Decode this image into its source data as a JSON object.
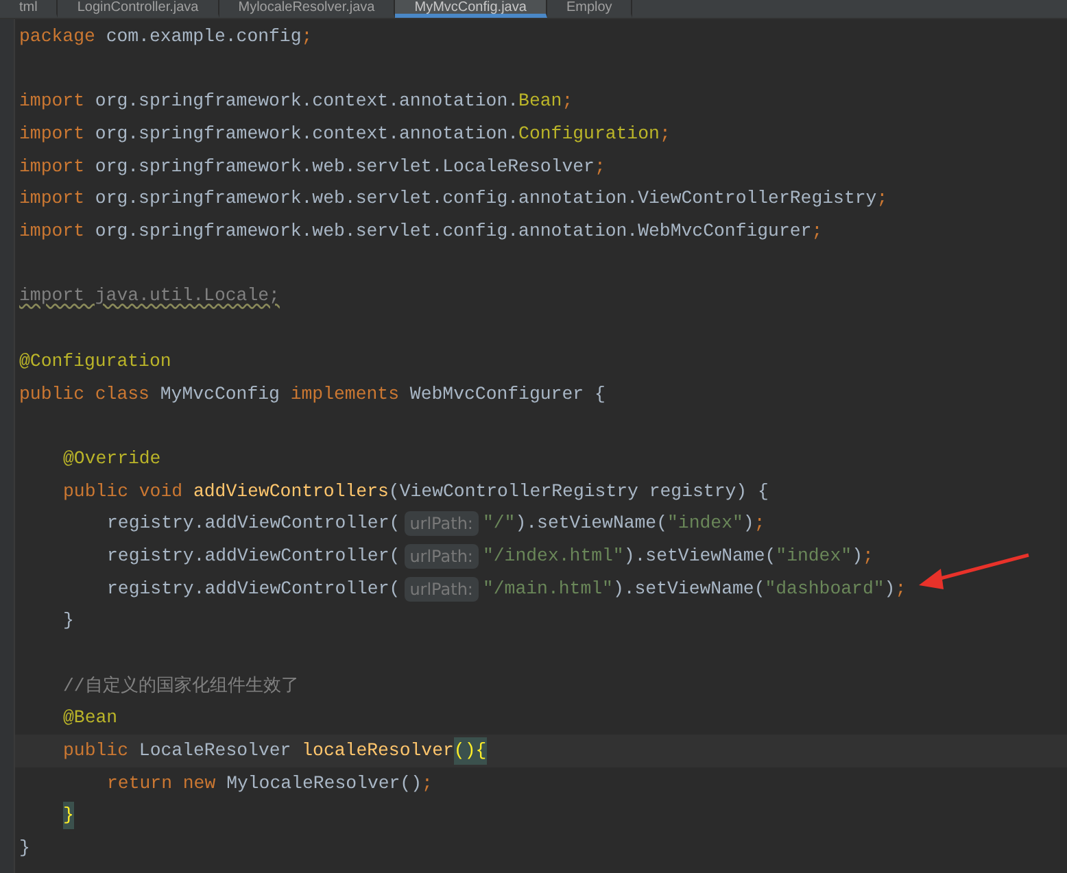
{
  "tabs": [
    {
      "label": "tml",
      "selected": false
    },
    {
      "label": "LoginController.java",
      "selected": false
    },
    {
      "label": "MylocaleResolver.java",
      "selected": false
    },
    {
      "label": "MyMvcConfig.java",
      "selected": true
    },
    {
      "label": "Employ",
      "selected": false
    }
  ],
  "lines": [
    {
      "kind": "top",
      "tokens": [
        {
          "kind": "keyword",
          "text": "package "
        },
        {
          "kind": "plain",
          "text": "com.example.config"
        },
        {
          "kind": "keyword",
          "text": ";"
        }
      ]
    },
    {
      "kind": "top"
    },
    {
      "kind": "top",
      "tokens": [
        {
          "kind": "keyword",
          "text": "import "
        },
        {
          "kind": "plain",
          "text": "org.springframework.context.annotation."
        },
        {
          "kind": "annotation",
          "text": "Bean"
        },
        {
          "kind": "keyword",
          "text": ";"
        }
      ]
    },
    {
      "kind": "top",
      "tokens": [
        {
          "kind": "keyword",
          "text": "import "
        },
        {
          "kind": "plain",
          "text": "org.springframework.context.annotation."
        },
        {
          "kind": "annotation",
          "text": "Configuration"
        },
        {
          "kind": "keyword",
          "text": ";"
        }
      ]
    },
    {
      "kind": "top",
      "tokens": [
        {
          "kind": "keyword",
          "text": "import "
        },
        {
          "kind": "plain",
          "text": "org.springframework.web.servlet.LocaleResolver"
        },
        {
          "kind": "keyword",
          "text": ";"
        }
      ]
    },
    {
      "kind": "top",
      "tokens": [
        {
          "kind": "keyword",
          "text": "import "
        },
        {
          "kind": "plain",
          "text": "org.springframework.web.servlet.config.annotation.ViewControllerRegistry"
        },
        {
          "kind": "keyword",
          "text": ";"
        }
      ]
    },
    {
      "kind": "top",
      "tokens": [
        {
          "kind": "keyword",
          "text": "import "
        },
        {
          "kind": "plain",
          "text": "org.springframework.web.servlet.config.annotation.WebMvcConfigurer"
        },
        {
          "kind": "keyword",
          "text": ";"
        }
      ]
    },
    {
      "kind": "top"
    },
    {
      "kind": "top",
      "tokens": [
        {
          "kind": "unused",
          "text": "import java.util.Locale;"
        }
      ]
    },
    {
      "kind": "top"
    },
    {
      "kind": "top",
      "tokens": [
        {
          "kind": "annotation",
          "text": "@Configuration"
        }
      ]
    },
    {
      "kind": "top",
      "tokens": [
        {
          "kind": "keyword",
          "text": "public class "
        },
        {
          "kind": "plain",
          "text": "MyMvcConfig "
        },
        {
          "kind": "keyword",
          "text": "implements "
        },
        {
          "kind": "plain",
          "text": "WebMvcConfigurer {"
        }
      ]
    },
    {
      "kind": "top"
    },
    {
      "kind": "member",
      "tokens": [
        {
          "kind": "annotation",
          "text": "@Override"
        }
      ]
    },
    {
      "kind": "member",
      "tokens": [
        {
          "kind": "keyword",
          "text": "public void "
        },
        {
          "kind": "method",
          "text": "addViewControllers"
        },
        {
          "kind": "plain",
          "text": "(ViewControllerRegistry registry) {"
        }
      ]
    },
    {
      "kind": "statement",
      "tokens": [
        {
          "kind": "plain",
          "text": "registry.addViewController("
        },
        {
          "kind": "hint",
          "text": "urlPath:"
        },
        {
          "kind": "string",
          "text": "\"/\""
        },
        {
          "kind": "plain",
          "text": ").setViewName("
        },
        {
          "kind": "string",
          "text": "\"index\""
        },
        {
          "kind": "plain",
          "text": ")"
        },
        {
          "kind": "keyword",
          "text": ";"
        }
      ]
    },
    {
      "kind": "statement",
      "tokens": [
        {
          "kind": "plain",
          "text": "registry.addViewController("
        },
        {
          "kind": "hint",
          "text": "urlPath:"
        },
        {
          "kind": "string",
          "text": "\"/index.html\""
        },
        {
          "kind": "plain",
          "text": ").setViewName("
        },
        {
          "kind": "string",
          "text": "\"index\""
        },
        {
          "kind": "plain",
          "text": ")"
        },
        {
          "kind": "keyword",
          "text": ";"
        }
      ]
    },
    {
      "kind": "statement",
      "tokens": [
        {
          "kind": "plain",
          "text": "registry.addViewController("
        },
        {
          "kind": "hint",
          "text": "urlPath:"
        },
        {
          "kind": "string",
          "text": "\"/main.html\""
        },
        {
          "kind": "plain",
          "text": ").setViewName("
        },
        {
          "kind": "string",
          "text": "\"dashboard\""
        },
        {
          "kind": "plain",
          "text": ")"
        },
        {
          "kind": "keyword",
          "text": ";"
        }
      ]
    },
    {
      "kind": "member",
      "tokens": [
        {
          "kind": "plain",
          "text": "}"
        }
      ]
    },
    {
      "kind": "top"
    },
    {
      "kind": "member",
      "tokens": [
        {
          "kind": "comment",
          "text": "//自定义的国家化组件生效了"
        }
      ]
    },
    {
      "kind": "member",
      "tokens": [
        {
          "kind": "annotation",
          "text": "@Bean"
        }
      ]
    },
    {
      "kind": "member",
      "current": true,
      "tokens": [
        {
          "kind": "keyword",
          "text": "public "
        },
        {
          "kind": "plain",
          "text": "LocaleResolver "
        },
        {
          "kind": "method",
          "text": "localeResolver"
        },
        {
          "kind": "match",
          "text": "()"
        },
        {
          "kind": "match",
          "text": "{"
        }
      ]
    },
    {
      "kind": "statement",
      "tokens": [
        {
          "kind": "keyword",
          "text": "return new "
        },
        {
          "kind": "plain",
          "text": "MylocaleResolver()"
        },
        {
          "kind": "keyword",
          "text": ";"
        }
      ]
    },
    {
      "kind": "member",
      "tokens": [
        {
          "kind": "match",
          "text": "}"
        }
      ]
    },
    {
      "kind": "top",
      "tokens": [
        {
          "kind": "plain",
          "text": "}"
        }
      ]
    }
  ]
}
